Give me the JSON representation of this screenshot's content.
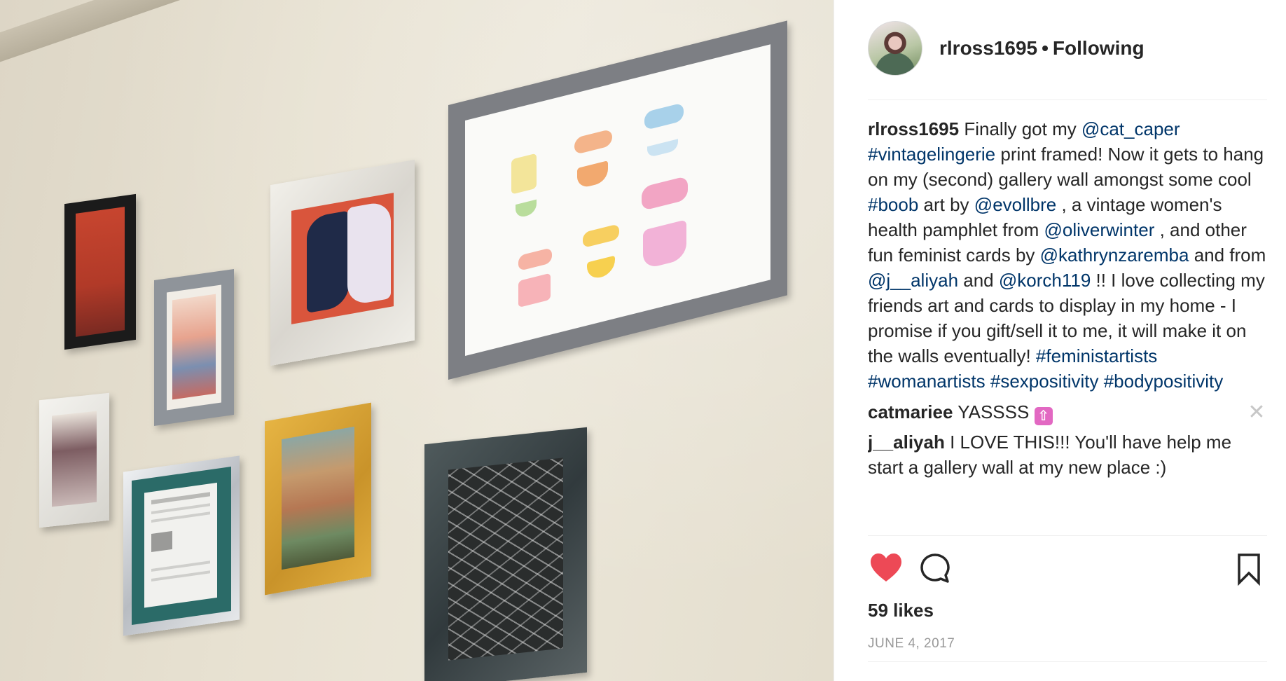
{
  "post": {
    "photo_description_icon": "framed-art-gallery-wall-photo",
    "header": {
      "username": "rlross1695",
      "separator": "•",
      "follow_status": "Following",
      "avatar_icon": "profile-avatar"
    },
    "caption": {
      "username": "rlross1695",
      "parts": [
        {
          "type": "text",
          "value": "Finally got my "
        },
        {
          "type": "link",
          "value": "@cat_caper"
        },
        {
          "type": "text",
          "value": " "
        },
        {
          "type": "link",
          "value": "#vintagelingerie"
        },
        {
          "type": "text",
          "value": " print framed! Now it gets to hang on my (second) gallery wall amongst some cool "
        },
        {
          "type": "link",
          "value": "#boob"
        },
        {
          "type": "text",
          "value": " art by "
        },
        {
          "type": "link",
          "value": "@evollbre"
        },
        {
          "type": "text",
          "value": " , a vintage women's health pamphlet from "
        },
        {
          "type": "link",
          "value": "@oliverwinter"
        },
        {
          "type": "text",
          "value": " , and other fun feminist cards by "
        },
        {
          "type": "link",
          "value": "@kathrynzaremba"
        },
        {
          "type": "text",
          "value": " and from "
        },
        {
          "type": "link",
          "value": "@j__aliyah"
        },
        {
          "type": "text",
          "value": " and "
        },
        {
          "type": "link",
          "value": "@korch119"
        },
        {
          "type": "text",
          "value": " !! I love collecting my friends art and cards to display in my home - I promise if you gift/sell it to me, it will make it on the walls eventually! "
        },
        {
          "type": "link",
          "value": "#feministartists"
        },
        {
          "type": "text",
          "value": " "
        },
        {
          "type": "link",
          "value": "#womanartists"
        },
        {
          "type": "text",
          "value": " "
        },
        {
          "type": "link",
          "value": "#sexpositivity"
        },
        {
          "type": "text",
          "value": " "
        },
        {
          "type": "link",
          "value": "#bodypositivity"
        }
      ]
    },
    "comments": [
      {
        "username": "catmariee",
        "text": "YASSSS",
        "emoji_icon": "up-arrow-emoji-icon",
        "emoji_glyph": "⇧",
        "delete_glyph": "✕"
      },
      {
        "username": "j__aliyah",
        "text": "I LOVE THIS!!! You'll have help me start a gallery wall at my new place :)"
      }
    ],
    "actions": {
      "like_icon": "heart-filled-icon",
      "comment_icon": "comment-bubble-icon",
      "save_icon": "bookmark-icon",
      "like_color": "#ed4956"
    },
    "likes": "59 likes",
    "date": "JUNE 4, 2017",
    "colors": {
      "link": "#003569",
      "text": "#262626",
      "muted": "#999999",
      "divider": "#efefef"
    }
  }
}
